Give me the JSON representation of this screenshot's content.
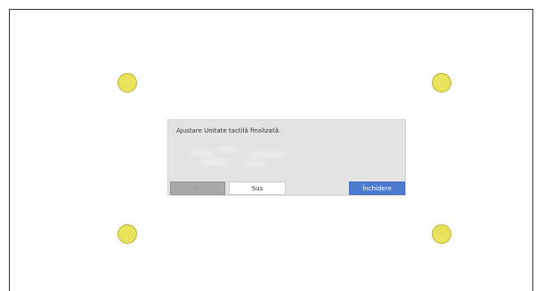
{
  "dialog": {
    "message": "Ajustare Unitate tactilă finalizată.",
    "buttons": {
      "down_label": "Jos",
      "up_label": "Sus",
      "close_label": "Închidere"
    }
  },
  "colors": {
    "target_fill": "#e8e35a",
    "dialog_bg": "#e3e3e3",
    "close_button": "#4b7cd0",
    "disabled_button": "#a9a9a9"
  }
}
